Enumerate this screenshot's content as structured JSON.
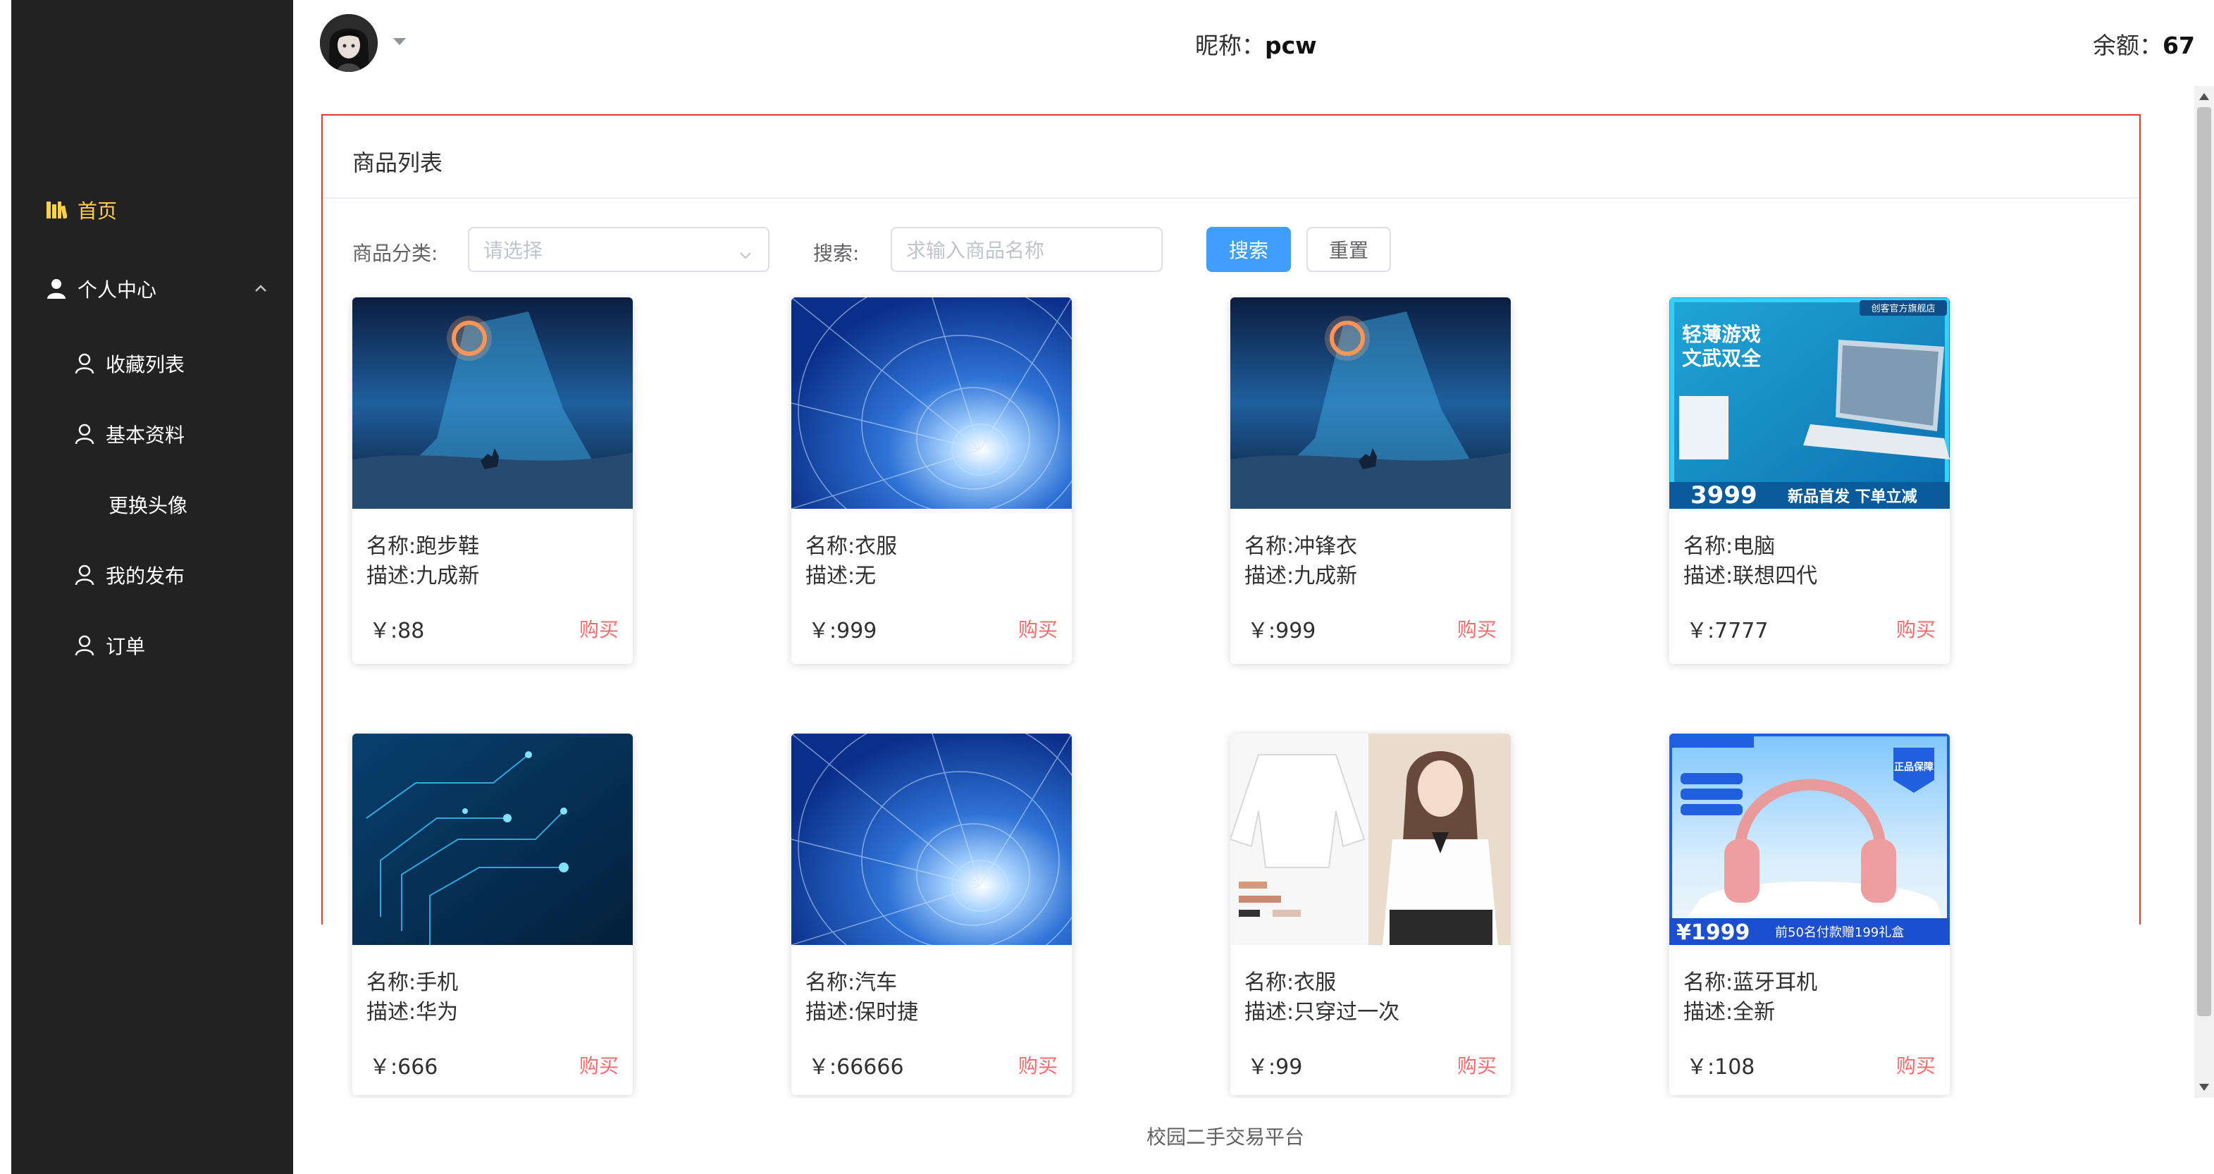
{
  "sidebar": {
    "items": [
      {
        "label": "首页",
        "icon": "bookshelf-icon",
        "active": true
      },
      {
        "label": "个人中心",
        "icon": "user-filled-icon",
        "expanded": true
      },
      {
        "label": "收藏列表",
        "icon": "user-outline-icon"
      },
      {
        "label": "基本资料",
        "icon": "user-outline-icon"
      },
      {
        "label": "更换头像",
        "icon": ""
      },
      {
        "label": "我的发布",
        "icon": "user-outline-icon"
      },
      {
        "label": "订单",
        "icon": "user-outline-icon"
      }
    ],
    "active_color": "#ffd04b",
    "background": "#222222"
  },
  "header": {
    "nick_label": "昵称：",
    "nick_value": "pcw",
    "balance_label": "余额：",
    "balance_value": "67"
  },
  "panel": {
    "title": "商品列表",
    "border_color": "#e53935"
  },
  "filters": {
    "category_label": "商品分类:",
    "category_placeholder": "请选择",
    "search_label": "搜索:",
    "search_placeholder": "求输入商品名称",
    "search_button": "搜索",
    "reset_button": "重置"
  },
  "products": [
    {
      "name": "名称:跑步鞋",
      "desc": "描述:九成新",
      "price": "￥:88",
      "buy": "购买",
      "image": "night-sky-deer"
    },
    {
      "name": "名称:衣服",
      "desc": "描述:无",
      "price": "￥:999",
      "buy": "购买",
      "image": "blue-tunnel"
    },
    {
      "name": "名称:冲锋衣",
      "desc": "描述:九成新",
      "price": "￥:999",
      "buy": "购买",
      "image": "night-sky-deer"
    },
    {
      "name": "名称:电脑",
      "desc": "描述:联想四代",
      "price": "￥:7777",
      "buy": "购买",
      "image": "laptop-ad"
    },
    {
      "name": "名称:手机",
      "desc": "描述:华为",
      "price": "￥:666",
      "buy": "购买",
      "image": "circuit-board"
    },
    {
      "name": "名称:汽车",
      "desc": "描述:保时捷",
      "price": "￥:66666",
      "buy": "购买",
      "image": "blue-tunnel"
    },
    {
      "name": "名称:衣服",
      "desc": "描述:只穿过一次",
      "price": "￥:99",
      "buy": "购买",
      "image": "white-blouse"
    },
    {
      "name": "名称:蓝牙耳机",
      "desc": "描述:全新",
      "price": "￥:108",
      "buy": "购买",
      "image": "headphones-ad"
    }
  ],
  "ads": {
    "laptop_badge": "创客官方旗舰店",
    "laptop_line1": "轻薄游戏",
    "laptop_line2": "文武双全",
    "laptop_price": "3999",
    "laptop_slogan": "新品首发 下单立减",
    "headphones_badge": "正品保障",
    "headphones_price": "¥1999",
    "headphones_promo": "前50名付款赠199礼盒"
  },
  "footer": {
    "text": "校园二手交易平台"
  }
}
